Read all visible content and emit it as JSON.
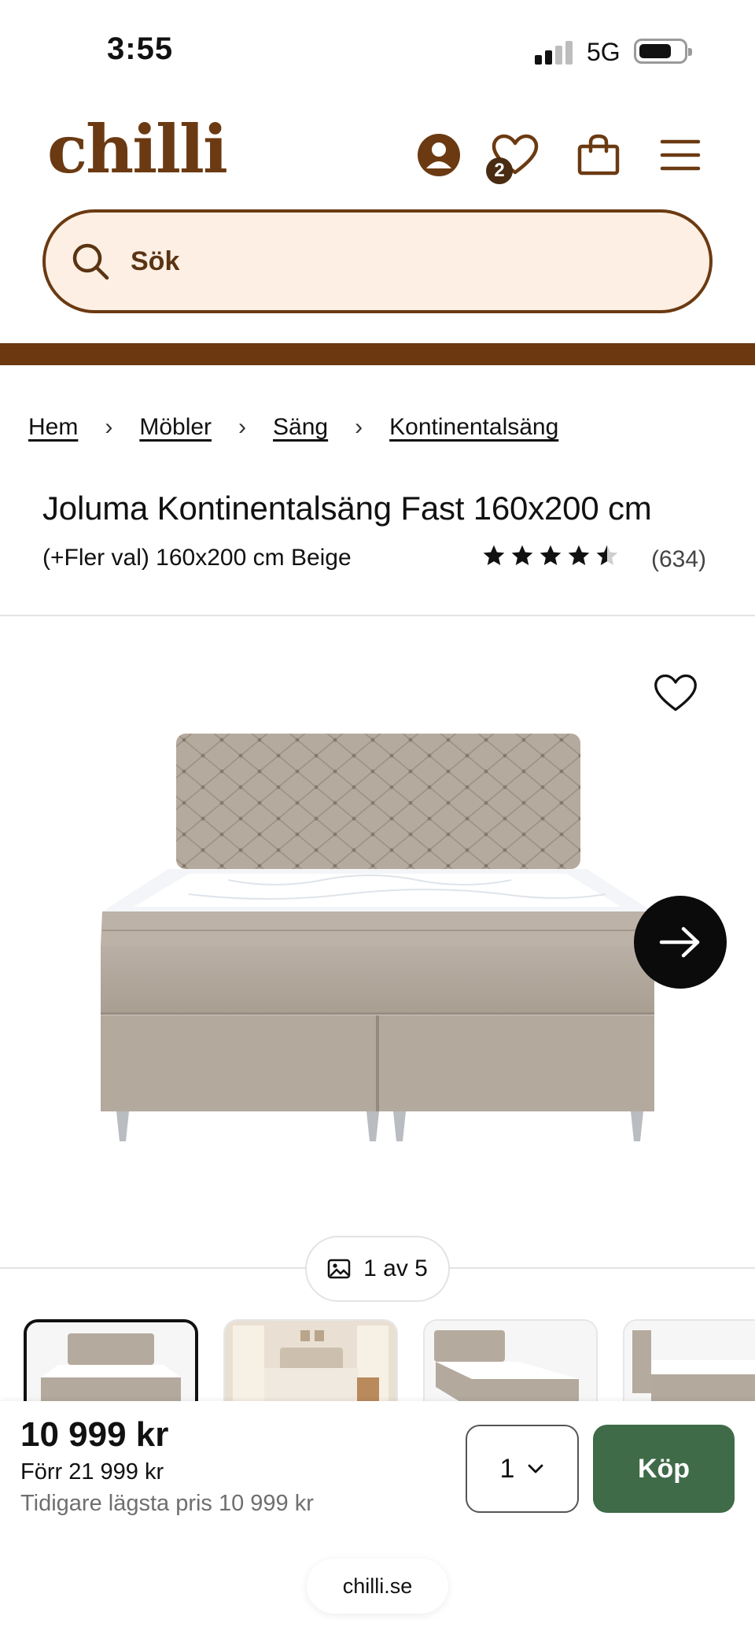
{
  "status_bar": {
    "time": "3:55",
    "network": "5G",
    "signal_bars_active": 2,
    "signal_bars_total": 4
  },
  "header": {
    "logo_text": "chilli",
    "brand_color": "#6b3a12",
    "icons": [
      "account-icon",
      "wishlist-icon",
      "cart-icon",
      "menu-icon"
    ],
    "wishlist_count": "2",
    "search_placeholder": "Sök"
  },
  "breadcrumb": [
    "Hem",
    "Möbler",
    "Säng",
    "Kontinentalsäng"
  ],
  "product": {
    "title": "Joluma Kontinentalsäng Fast 160x200 cm",
    "variant": "(+Fler val) 160x200 cm Beige",
    "rating": 4.5,
    "rating_max": 5,
    "review_count": "(634)",
    "image_counter": "1 av 5"
  },
  "purchase": {
    "price": "10 999 kr",
    "previous_price": "Förr 21 999 kr",
    "lowest_price": "Tidigare lägsta pris 10 999 kr",
    "quantity": "1",
    "buy_label": "Köp",
    "buy_color": "#3f6b48"
  },
  "browser": {
    "url": "chilli.se"
  }
}
